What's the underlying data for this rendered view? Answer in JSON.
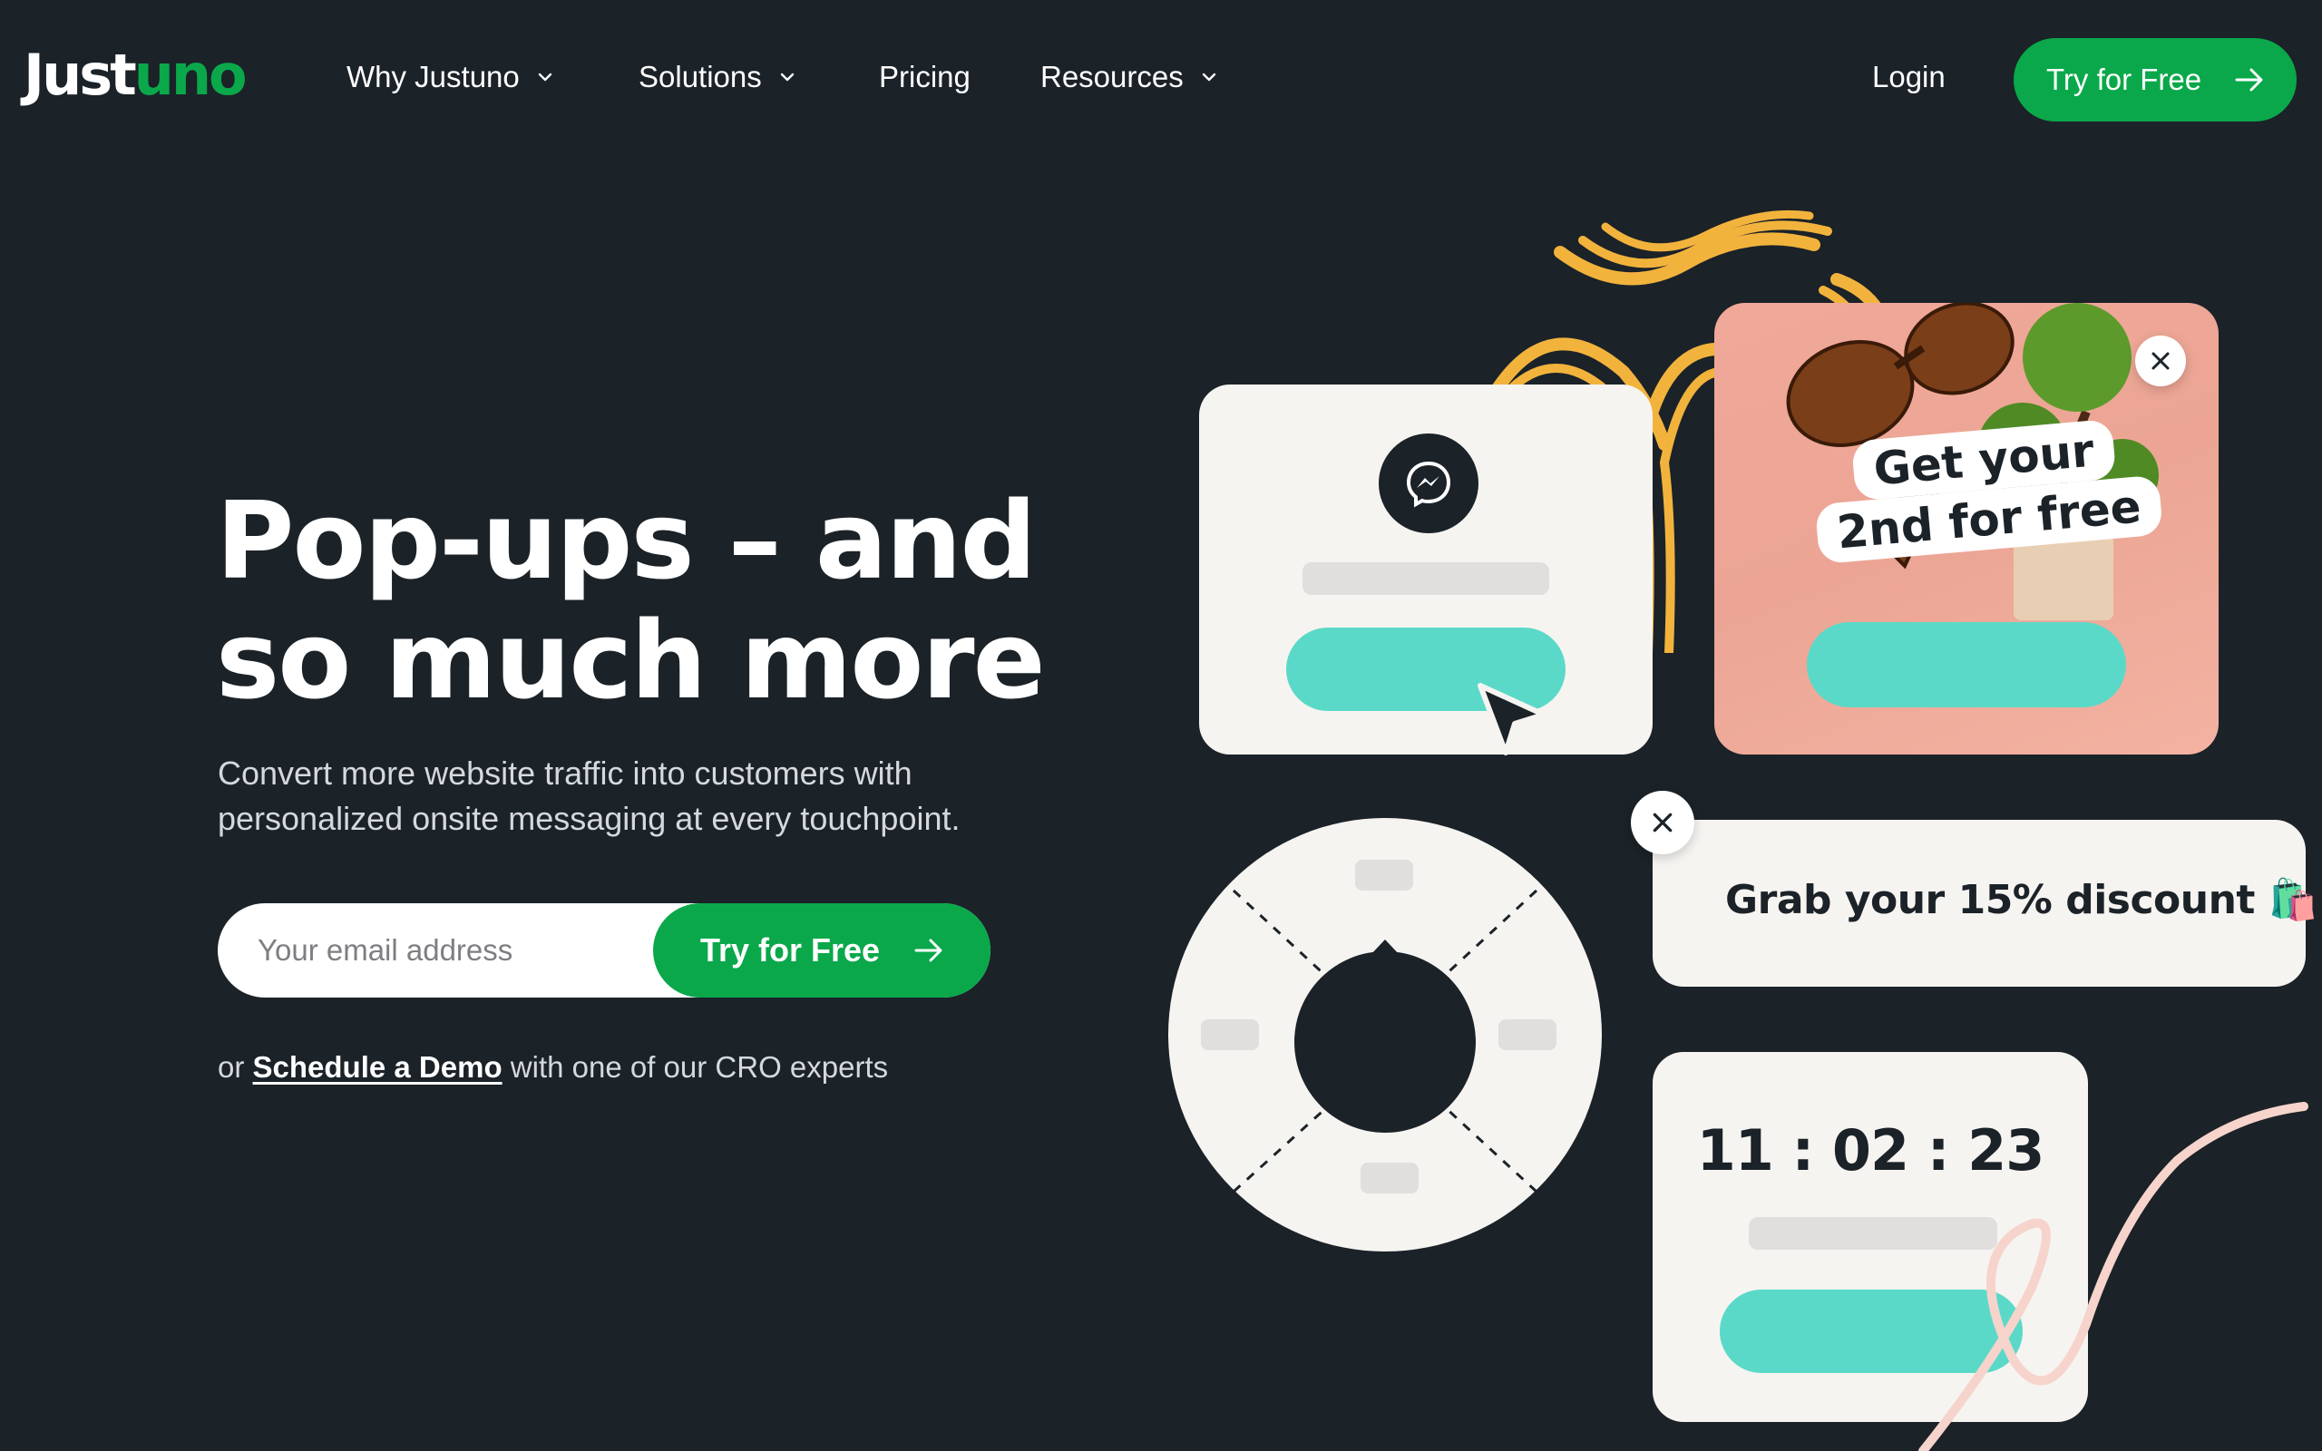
{
  "brand": {
    "logo_part1": "Just",
    "logo_part2": "uno",
    "primary_green": "#0aa84a",
    "background": "#1b2228",
    "teal": "#5bd9c8",
    "swirl_yellow": "#f2b33d"
  },
  "nav": {
    "items": [
      {
        "label": "Why Justuno",
        "icon": "chevron-down-icon"
      },
      {
        "label": "Solutions",
        "icon": "chevron-down-icon"
      },
      {
        "label": "Pricing"
      },
      {
        "label": "Resources",
        "icon": "chevron-down-icon"
      }
    ],
    "login_label": "Login",
    "cta_label": "Try for Free",
    "cta_icon": "arrow-right-icon"
  },
  "hero": {
    "headline_line1": "Pop-ups – and",
    "headline_line2": "so much more",
    "subheadline": "Convert more website traffic into customers with personalized onsite messaging at every touchpoint.",
    "email_placeholder": "Your email address",
    "email_value": "",
    "cta_label": "Try for Free",
    "demo_prefix": "or ",
    "demo_link": "Schedule a Demo",
    "demo_suffix": " with one of our CRO experts"
  },
  "illustrations": {
    "messenger_card": {
      "icon": "messenger-icon"
    },
    "promo_card": {
      "line1": "Get your",
      "line2": "2nd for free",
      "close_icon": "close-icon"
    },
    "discount_card": {
      "text": "Grab your 15% discount",
      "emoji": "🛍️",
      "close_icon": "close-icon"
    },
    "wheel": {
      "segments": 4
    },
    "timer_card": {
      "time": "11 : 02 : 23"
    }
  }
}
